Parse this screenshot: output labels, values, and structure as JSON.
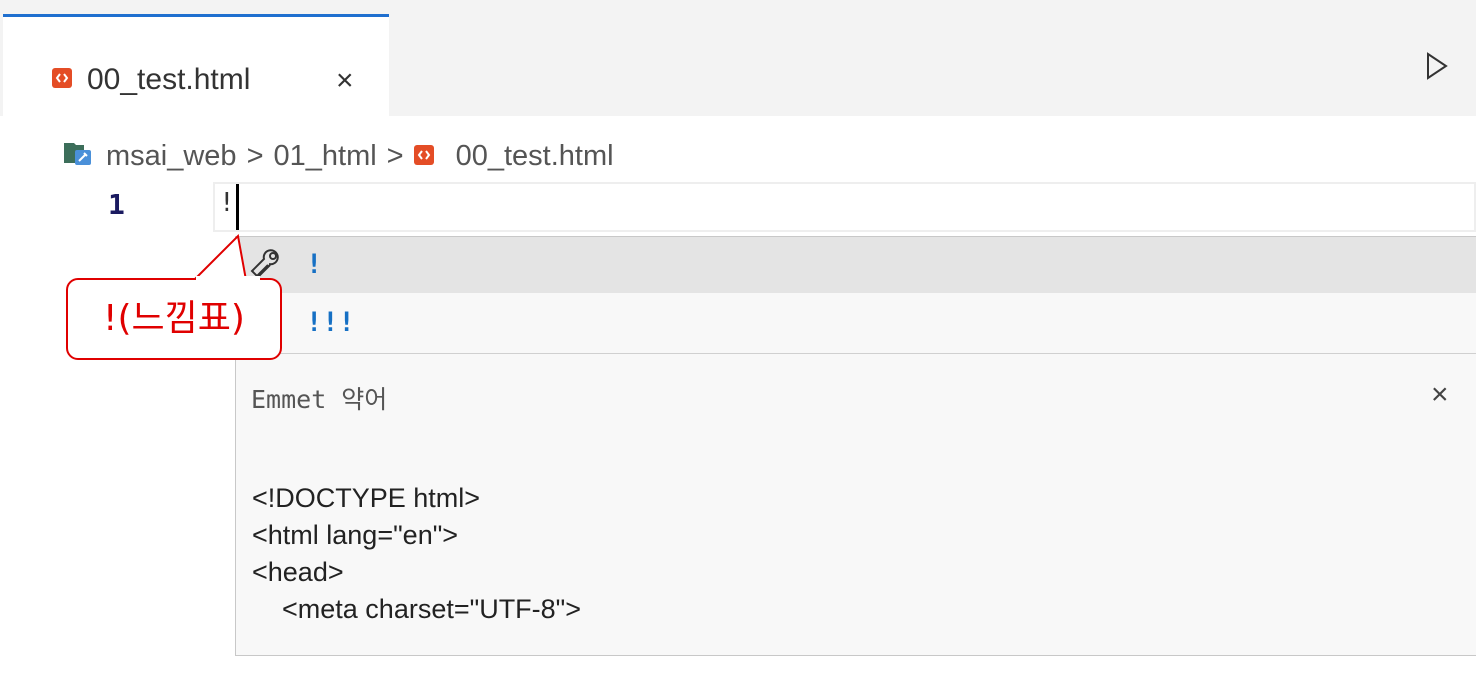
{
  "tab": {
    "label": "00_test.html",
    "close_glyph": "×",
    "icon": "html-file-icon"
  },
  "toolbar": {
    "run_icon": "play-icon"
  },
  "breadcrumb": {
    "items": [
      "msai_web",
      "01_html",
      "00_test.html"
    ],
    "separator": ">"
  },
  "editor": {
    "line_number": "1",
    "line_text": "!"
  },
  "suggestions": {
    "items": [
      {
        "label": "!",
        "icon": "wrench-icon",
        "selected": true
      },
      {
        "label": "!!!",
        "icon": "wrench-icon",
        "selected": false
      }
    ],
    "details": {
      "title": "Emmet 약어",
      "close_glyph": "×",
      "lines": [
        "<!DOCTYPE html>",
        "<html lang=\"en\">",
        "<head>",
        "    <meta charset=\"UTF-8\">"
      ]
    }
  },
  "annotation": {
    "text": "!(느낌표)",
    "color": "#e00000"
  },
  "colors": {
    "tab_accent": "#1f6fcf",
    "html_icon": "#e44d26",
    "suggestion_text": "#1670c4"
  }
}
